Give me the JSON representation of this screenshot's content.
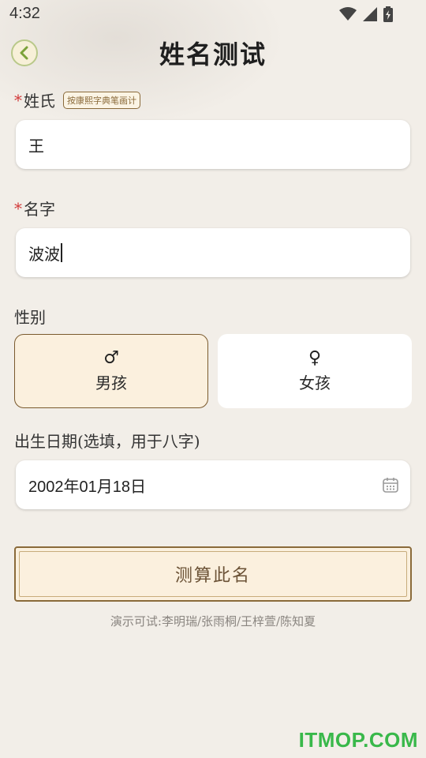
{
  "status_bar": {
    "time": "4:32"
  },
  "header": {
    "title": "姓名测试"
  },
  "surname": {
    "required_mark": "*",
    "label": "姓氏",
    "hint": "按康熙字典笔画计",
    "value": "王"
  },
  "given_name": {
    "required_mark": "*",
    "label": "名字",
    "value": "波波"
  },
  "gender": {
    "label": "性别",
    "options": [
      {
        "label": "男孩",
        "symbol": "♂",
        "selected": true
      },
      {
        "label": "女孩",
        "symbol": "♀",
        "selected": false
      }
    ]
  },
  "birth_date": {
    "label": "出生日期(选填，用于八字)",
    "value": "2002年01月18日"
  },
  "submit": {
    "label": "测算此名"
  },
  "demo_text": "演示可试:李明瑞/张雨桐/王梓萱/陈知夏",
  "watermark": "ITMOP.COM",
  "colors": {
    "accent_brown": "#8a6a3a",
    "selected_bg": "#fbf0de",
    "required_red": "#d23a3a",
    "watermark_green": "#39b84a"
  }
}
